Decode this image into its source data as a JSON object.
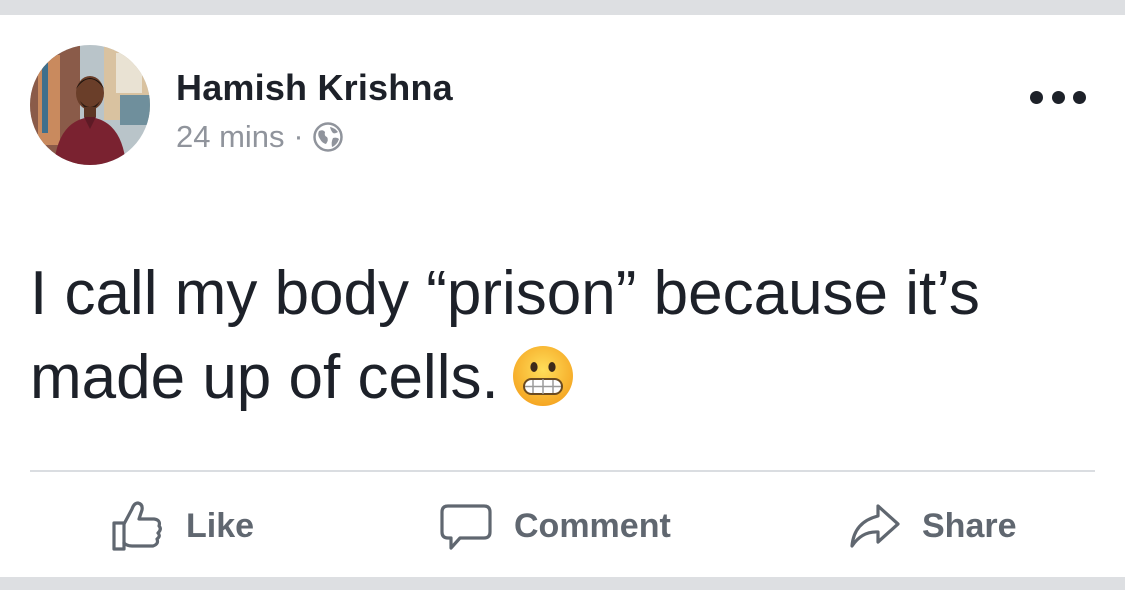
{
  "post": {
    "author": "Hamish Krishna",
    "time": "24 mins",
    "separator": "·",
    "privacy_icon": "globe-icon",
    "text_lines": [
      "I call my body “prison” because it’s",
      "made up of cells."
    ],
    "emoji": "grimacing-face"
  },
  "actions": {
    "like": "Like",
    "comment": "Comment",
    "share": "Share"
  },
  "colors": {
    "primary_text": "#1d2129",
    "secondary_text": "#90949c",
    "action_text": "#606770",
    "separator_bar": "#dddfe2"
  }
}
